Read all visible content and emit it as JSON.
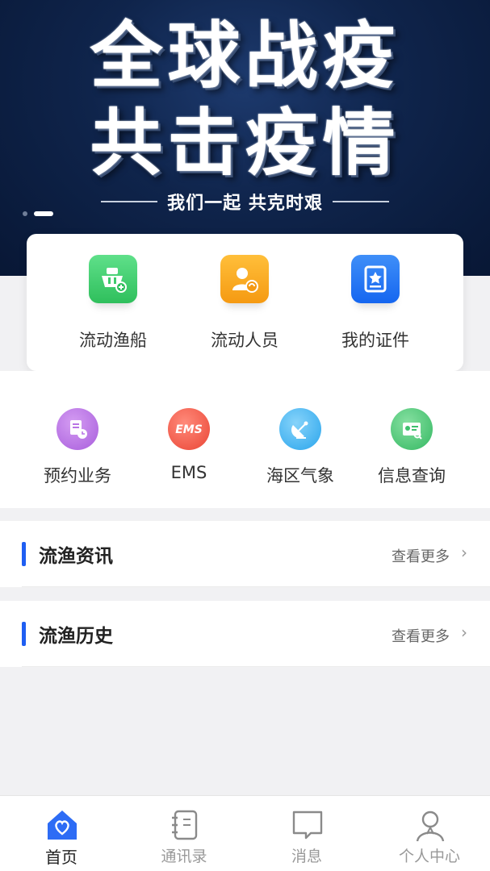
{
  "banner": {
    "line1": "全球战疫",
    "line2": "共击疫情",
    "subtitle": "我们一起 共克时艰"
  },
  "quick_actions": [
    {
      "label": "流动渔船",
      "icon": "fishing-boat-icon",
      "color": "#3ecb6b"
    },
    {
      "label": "流动人员",
      "icon": "person-refresh-icon",
      "color": "#f7a31b"
    },
    {
      "label": "我的证件",
      "icon": "certificate-icon",
      "color": "#1677f5"
    }
  ],
  "services": [
    {
      "label": "预约业务",
      "icon": "appointment-icon",
      "color": "#b974e5"
    },
    {
      "label": "EMS",
      "icon": "ems-icon",
      "color": "#f2594a"
    },
    {
      "label": "海区气象",
      "icon": "satellite-dish-icon",
      "color": "#3fb4f1"
    },
    {
      "label": "信息查询",
      "icon": "id-card-search-icon",
      "color": "#3fc06d"
    }
  ],
  "sections": [
    {
      "title": "流渔资讯",
      "more": "查看更多"
    },
    {
      "title": "流渔历史",
      "more": "查看更多"
    }
  ],
  "tabbar": [
    {
      "label": "首页",
      "icon": "home-heart-icon",
      "active": true
    },
    {
      "label": "通讯录",
      "icon": "contacts-book-icon",
      "active": false
    },
    {
      "label": "消息",
      "icon": "message-bubble-icon",
      "active": false
    },
    {
      "label": "个人中心",
      "icon": "user-profile-icon",
      "active": false
    }
  ],
  "colors": {
    "accent": "#1f5ef2",
    "banner_bg": "#0f244b"
  }
}
